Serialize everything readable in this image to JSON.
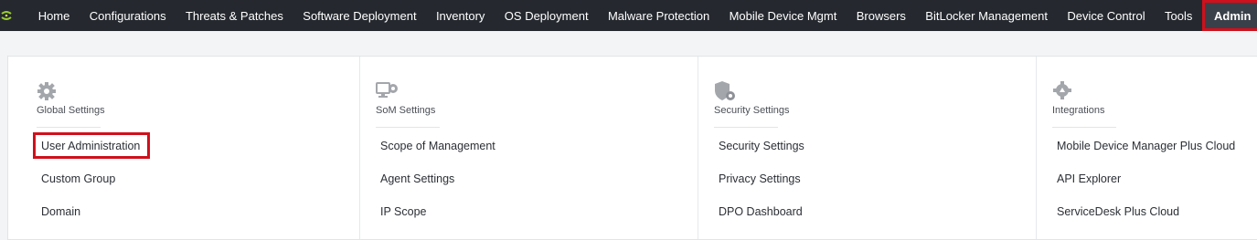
{
  "nav": {
    "items": [
      {
        "label": "Home"
      },
      {
        "label": "Configurations"
      },
      {
        "label": "Threats & Patches"
      },
      {
        "label": "Software Deployment"
      },
      {
        "label": "Inventory"
      },
      {
        "label": "OS Deployment"
      },
      {
        "label": "Malware Protection"
      },
      {
        "label": "Mobile Device Mgmt"
      },
      {
        "label": "Browsers"
      },
      {
        "label": "BitLocker Management"
      },
      {
        "label": "Device Control"
      },
      {
        "label": "Tools"
      },
      {
        "label": "Admin"
      }
    ],
    "active": "Admin"
  },
  "columns": [
    {
      "title": "Global Settings",
      "icon": "gear-icon",
      "links": [
        "User Administration",
        "Custom Group",
        "Domain"
      ]
    },
    {
      "title": "SoM Settings",
      "icon": "computer-gear-icon",
      "links": [
        "Scope of Management",
        "Agent Settings",
        "IP Scope"
      ]
    },
    {
      "title": "Security Settings",
      "icon": "shield-gear-icon",
      "links": [
        "Security Settings",
        "Privacy Settings",
        "DPO Dashboard"
      ]
    },
    {
      "title": "Integrations",
      "icon": "integration-gear-icon",
      "links": [
        "Mobile Device Manager Plus Cloud",
        "API Explorer",
        "ServiceDesk Plus Cloud"
      ]
    }
  ],
  "colors": {
    "nav_bg": "#25292f",
    "highlight": "#d0101c",
    "icon_gray": "#9a9da2"
  }
}
